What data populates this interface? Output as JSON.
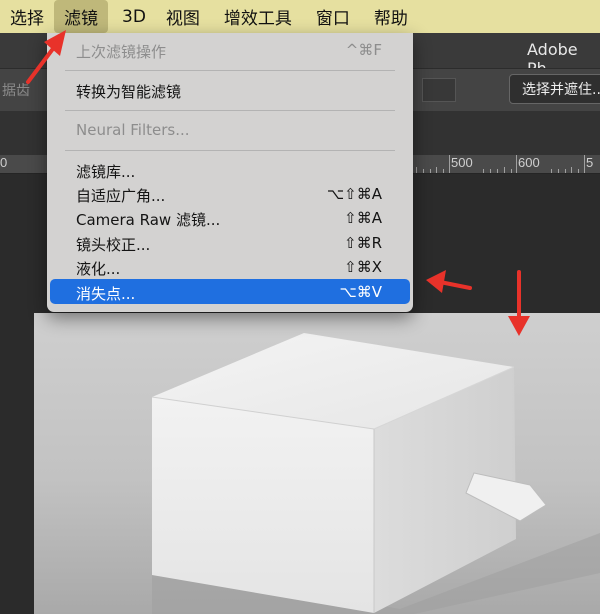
{
  "menubar": {
    "items": [
      "选择",
      "滤镜",
      "3D",
      "视图",
      "增效工具",
      "窗口",
      "帮助"
    ],
    "active_index": 1
  },
  "app": {
    "title": "Adobe Ph"
  },
  "options": {
    "left_label": "据齿",
    "button": "选择并遮住..."
  },
  "ruler": {
    "labels": [
      "0",
      "500",
      "600",
      "5"
    ]
  },
  "filter_menu": {
    "items": [
      {
        "label": "上次滤镜操作",
        "shortcut": "^⌘F",
        "disabled": true
      },
      {
        "label": "转换为智能滤镜",
        "shortcut": "",
        "disabled": false
      },
      {
        "label": "Neural Filters...",
        "shortcut": "",
        "disabled": true
      },
      {
        "label": "滤镜库...",
        "shortcut": "",
        "disabled": false
      },
      {
        "label": "自适应广角...",
        "shortcut": "⌥⇧⌘A",
        "disabled": false
      },
      {
        "label": "Camera Raw 滤镜...",
        "shortcut": "⇧⌘A",
        "disabled": false
      },
      {
        "label": "镜头校正...",
        "shortcut": "⇧⌘R",
        "disabled": false
      },
      {
        "label": "液化...",
        "shortcut": "⇧⌘X",
        "disabled": false
      },
      {
        "label": "消失点...",
        "shortcut": "⌥⌘V",
        "disabled": false,
        "highlighted": true
      }
    ]
  },
  "colors": {
    "menubar_bg": "#e6e0a0",
    "highlight": "#1f6fe0",
    "annotation_arrow": "#e8322a"
  }
}
